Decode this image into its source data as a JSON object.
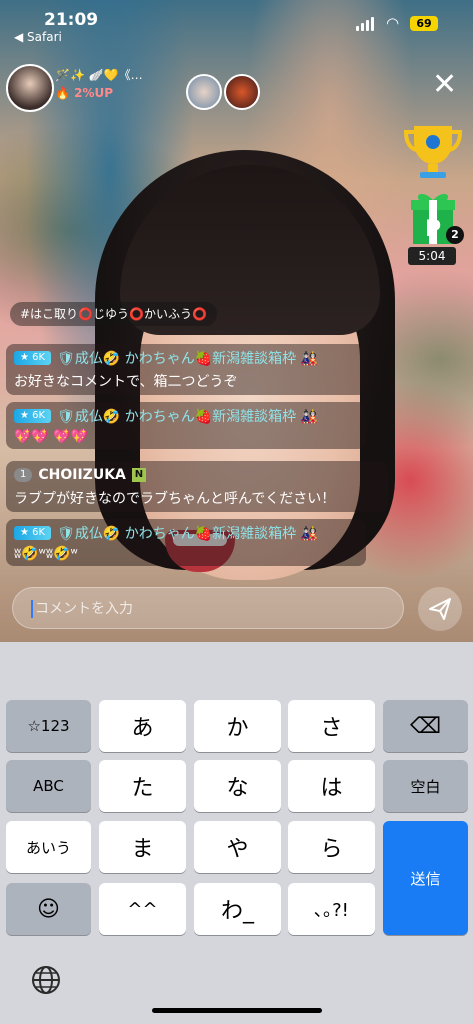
{
  "status_bar": {
    "time": "21:09",
    "back_app": "◀ Safari",
    "battery": "69"
  },
  "host": {
    "line1": "🪄✨ 🪽💛《…",
    "line2": "🔥 2%UP"
  },
  "close_icon": "close-icon",
  "gift_count": "2",
  "gift_timer": "5:04",
  "hashtag": "#はこ取り⭕️じゆう⭕️かいふう⭕️",
  "messages": [
    {
      "badge": "6K",
      "user": "🛡成仏🤣 かわちゃん🍓新潟雑談箱枠 🎎",
      "text": "お好きなコメントで、箱二つどうぞ"
    },
    {
      "badge": "6K",
      "user": "🛡成仏🤣 かわちゃん🍓新潟雑談箱枠 🎎",
      "text": "💖💖 💖💖"
    },
    {
      "badge": "1",
      "user": "CHOIIZUKA",
      "tag": "N",
      "text": "ラブプが好きなのでラブちゃんと呼んでください！"
    },
    {
      "badge": "6K",
      "user": "🛡成仏🤣 かわちゃん🍓新潟雑談箱枠 🎎",
      "text": "ʬ🤣ʷʬ🤣ʷ"
    }
  ],
  "comment_input": {
    "placeholder": "コメントを入力"
  },
  "keyboard": {
    "row1": [
      "☆123",
      "あ",
      "か",
      "さ",
      "⌫"
    ],
    "row2": [
      "ABC",
      "た",
      "な",
      "は",
      "空白"
    ],
    "row3": [
      "あいう",
      "ま",
      "や",
      "ら",
      "送信"
    ],
    "row4": [
      "☺",
      "^^",
      "わ_",
      "､｡?!"
    ]
  }
}
